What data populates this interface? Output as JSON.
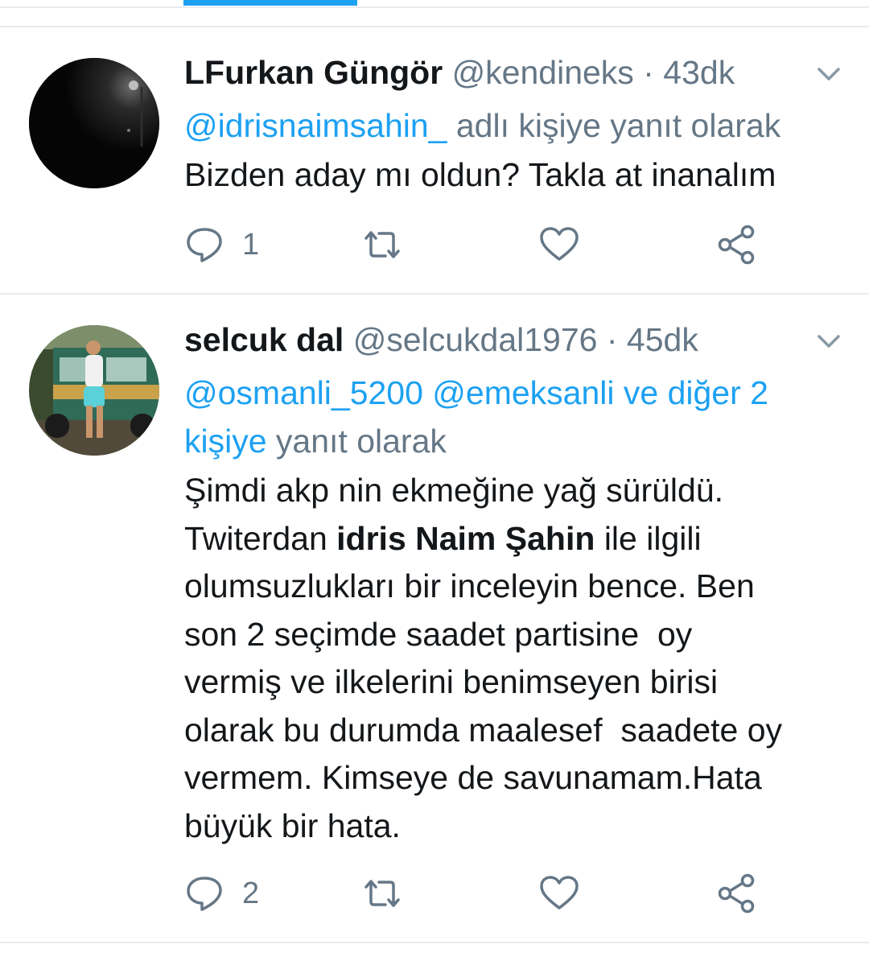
{
  "tweets": [
    {
      "name": "LFurkan Güngör",
      "handle": "@kendineks",
      "separator": "·",
      "time": "43dk",
      "reply_mentions": "@idrisnaimsahin_",
      "reply_suffix": " adlı kişiye yanıt olarak",
      "text": "Bizden aday mı oldun? Takla at inanalım",
      "reply_count": "1",
      "avatar": "dark-night-street-photo"
    },
    {
      "name": "selcuk dal",
      "handle": "@selcukdal1976",
      "separator": "·",
      "time": "45dk",
      "reply_mentions_line1": "@osmanli_5200 @emeksanli ve diğer 2",
      "reply_mentions_line2": "kişiye",
      "reply_suffix": " yanıt olarak",
      "text_line1": "Şimdi akp nin ekmeğine yağ sürüldü.",
      "text_line2_before": "Twiterdan ",
      "text_line2_bold": "idris Naim Şahin",
      "text_line2_after": " ile ilgili",
      "text_line3": "olumsuzlukları bir inceleyin bence. Ben",
      "text_line4": "son 2 seçimde saadet partisine  oy",
      "text_line5": "vermiş ve ilkelerini benimseyen birisi",
      "text_line6": "olarak bu durumda maalesef  saadete oy",
      "text_line7": "vermem. Kimseye de savunamam.Hata",
      "text_line8": "büyük bir hata.",
      "reply_count": "2",
      "avatar": "man-in-front-of-truck-photo"
    }
  ],
  "icons": {
    "reply": "reply-bubble-icon",
    "retweet": "retweet-icon",
    "like": "heart-icon",
    "share": "share-icon",
    "menu": "chevron-down-icon"
  },
  "colors": {
    "accent": "#1da1f2",
    "secondary_text": "#657786",
    "primary_text": "#14171a",
    "divider": "#e6ecf0"
  }
}
